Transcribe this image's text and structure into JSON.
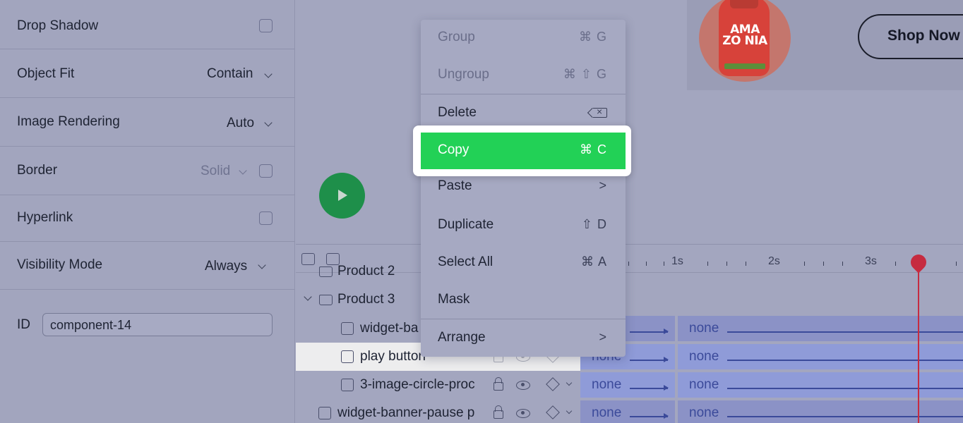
{
  "properties": {
    "drop_shadow": {
      "label": "Drop Shadow"
    },
    "object_fit": {
      "label": "Object Fit",
      "value": "Contain"
    },
    "image_rendering": {
      "label": "Image Rendering",
      "value": "Auto"
    },
    "border": {
      "label": "Border",
      "value": "Solid"
    },
    "hyperlink": {
      "label": "Hyperlink"
    },
    "visibility_mode": {
      "label": "Visibility Mode",
      "value": "Always"
    },
    "id": {
      "label": "ID",
      "value": "component-14"
    }
  },
  "canvas": {
    "shop_button_label": "Shop Now",
    "product_brand": "AMA ZO NIA",
    "play_icon": "play-icon"
  },
  "timeline": {
    "ticks": [
      "1s",
      "2s",
      "3s"
    ],
    "layers": [
      {
        "name": "Product 2",
        "type": "folder"
      },
      {
        "name": "Product 3",
        "type": "folder"
      },
      {
        "name": "widget-ba",
        "type": "widget"
      },
      {
        "name": "play button",
        "type": "image"
      },
      {
        "name": "3-image-circle-proc",
        "type": "image"
      },
      {
        "name": "widget-banner-pause p",
        "type": "widget"
      }
    ],
    "track_value": "none"
  },
  "context_menu": {
    "items": [
      {
        "label": "Group",
        "shortcut": "⌘ G",
        "disabled": true
      },
      {
        "label": "Ungroup",
        "shortcut": "⌘ ⇧ G",
        "disabled": true
      },
      {
        "label": "Delete",
        "shortcut_icon": "backspace-icon"
      },
      {
        "label": "Copy",
        "shortcut": "⌘ C",
        "highlighted": true
      },
      {
        "label": "Paste",
        "shortcut": ">"
      },
      {
        "label": "Duplicate",
        "shortcut": "⇧ D"
      },
      {
        "label": "Select All",
        "shortcut": "⌘ A"
      },
      {
        "label": "Mask",
        "shortcut": ""
      },
      {
        "label": "Arrange",
        "shortcut": ">"
      }
    ]
  },
  "colors": {
    "highlight": "#22d156",
    "playhead": "#c62b40",
    "selected_row": "#ededee",
    "play_button": "#1e8f4a"
  }
}
